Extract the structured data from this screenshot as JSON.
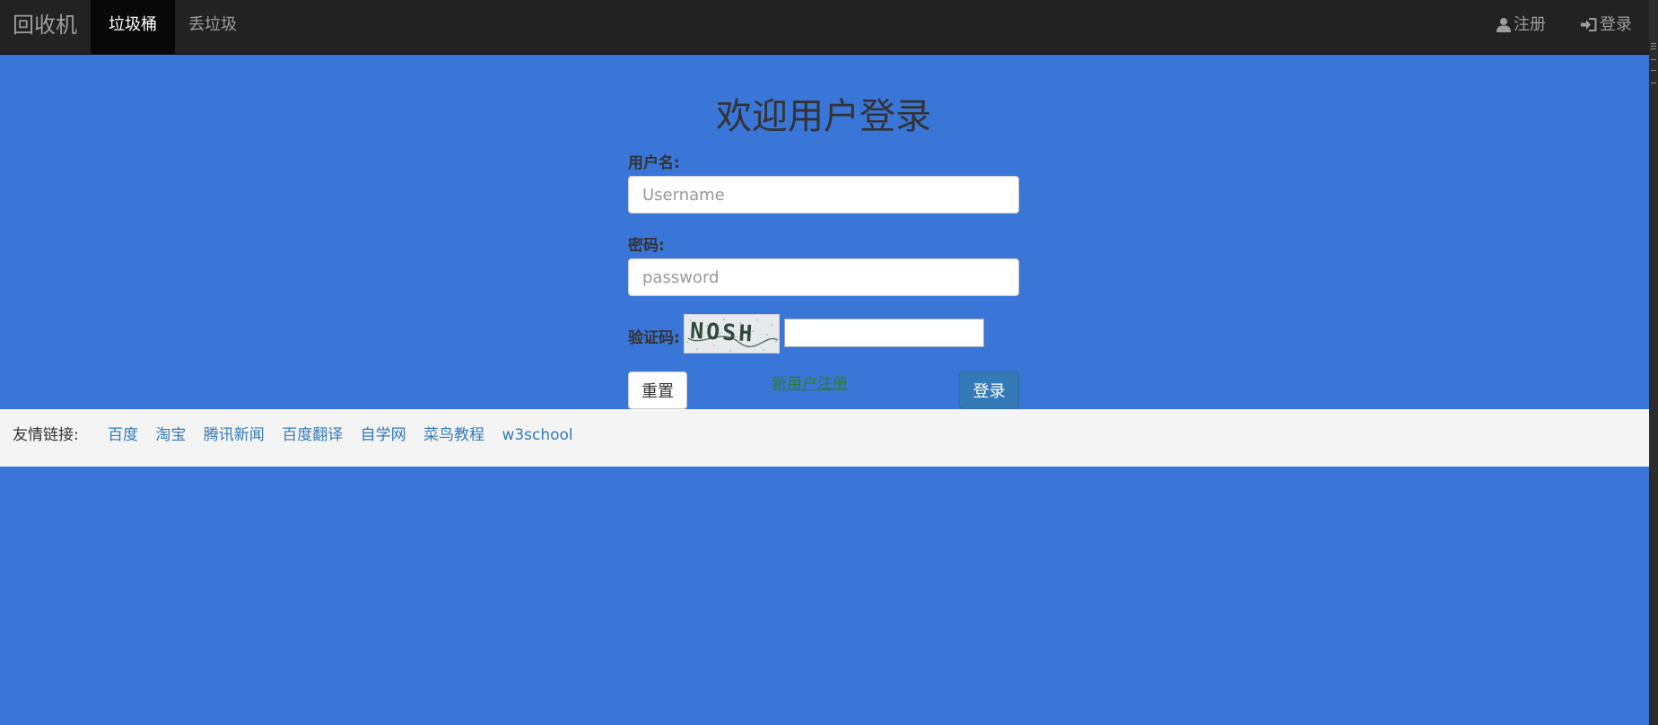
{
  "navbar": {
    "brand": "回收机",
    "tabs": [
      {
        "label": "垃圾桶",
        "active": true
      },
      {
        "label": "丢垃圾",
        "active": false
      }
    ],
    "right": {
      "register": {
        "label": "注册",
        "icon": "user-icon"
      },
      "login": {
        "label": "登录",
        "icon": "sign-in-icon"
      }
    }
  },
  "form": {
    "title": "欢迎用户登录",
    "username_label": "用户名:",
    "username_placeholder": "Username",
    "password_label": "密码:",
    "password_placeholder": "password",
    "captcha_label": "验证码:",
    "captcha_text": "NOSH",
    "reset_label": "重置",
    "register_link": "新用户注册",
    "login_label": "登录"
  },
  "footer": {
    "label": "友情链接:",
    "links": [
      "百度",
      "淘宝",
      "腾讯新闻",
      "百度翻译",
      "自学网",
      "菜鸟教程",
      "w3school"
    ]
  },
  "colors": {
    "page_bg": "#3a75d8",
    "navbar_bg": "#222222",
    "active_tab_bg": "#080808",
    "primary_button": "#337ab7",
    "footer_bg": "#f4f4f4",
    "link": "#337ab7",
    "register_link": "#2e7d32"
  }
}
